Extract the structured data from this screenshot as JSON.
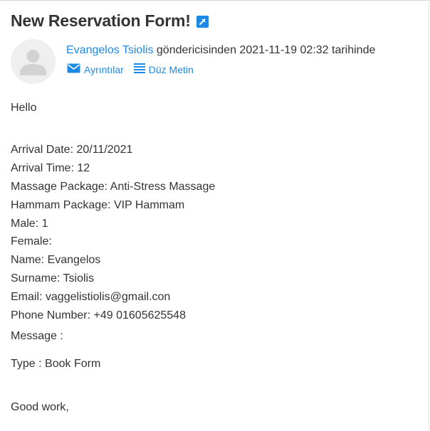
{
  "email": {
    "subject": "New Reservation Form!",
    "sender_name": "Evangelos Tsiolis",
    "sender_suffix": "göndericisinden 2021-11-19 02:32 tarihinde",
    "actions": {
      "details_label": "Ayrıntılar",
      "plain_text_label": "Düz Metin"
    },
    "body": {
      "greeting": "Hello",
      "fields": [
        "Arrival Date: 20/11/2021",
        "Arrival Time: 12",
        "Massage Package: Anti-Stress Massage",
        "Hammam Package: VIP Hammam",
        "Male: 1",
        "Female:",
        "Name: Evangelos",
        "Surname: Tsiolis",
        "Email: vaggelistiolis@gmail.con",
        "Phone Number: +49 01605625548"
      ],
      "message_line": "Message :",
      "type_line": "Type : Book Form",
      "closing": "Good work,"
    }
  },
  "icons": {
    "external_link": "external-link-icon",
    "avatar": "user-avatar-icon",
    "details": "envelope-icon",
    "plain_text": "lines-icon"
  },
  "colors": {
    "accent": "#1e88e5",
    "text": "#333333",
    "avatar_bg": "#efefef",
    "avatar_fg": "#d2d2d2"
  }
}
